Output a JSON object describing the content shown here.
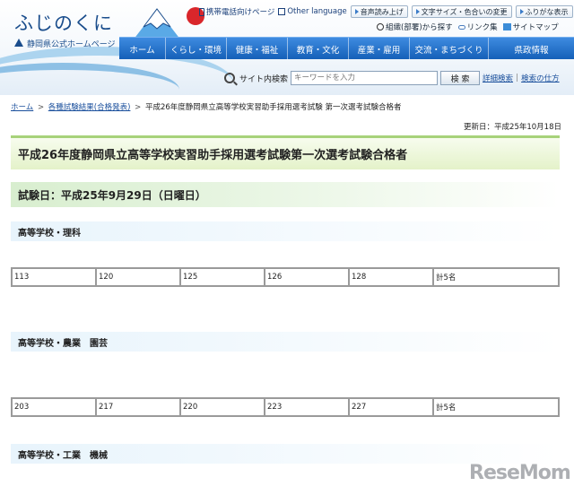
{
  "header": {
    "logo_title": "ふじのくに",
    "logo_sub": "静岡県公式ホームページ",
    "utility_links": [
      "携帯電話向けページ",
      "Other language"
    ],
    "utility_buttons": [
      "音声読み上げ",
      "文字サイズ・色合いの変更",
      "ふりがな表示"
    ],
    "utility_links2": [
      "組織(部署)から探す",
      "リンク集",
      "サイトマップ"
    ]
  },
  "nav": {
    "items": [
      "ホーム",
      "くらし・環境",
      "健康・福祉",
      "教育・文化",
      "産業・雇用",
      "交流・まちづくり",
      "県政情報"
    ]
  },
  "search": {
    "label": "サイト内検索",
    "placeholder": "キーワードを入力",
    "button": "検 索",
    "link_advanced": "詳細検索",
    "link_howto": "検索の仕方"
  },
  "breadcrumb": {
    "home": "ホーム",
    "category": "各種試験結果(合格発表)",
    "current": "平成26年度静岡県立高等学校実習助手採用選考試験 第一次選考試験合格者"
  },
  "updated": "更新日：平成25年10月18日",
  "page_title": "平成26年度静岡県立高等学校実習助手採用選考試験第一次選考試験合格者",
  "exam_date": "試験日：平成25年9月29日（日曜日）",
  "sections": [
    {
      "heading": "高等学校・理科",
      "cells": [
        "113",
        "120",
        "125",
        "126",
        "128",
        "計5名"
      ]
    },
    {
      "heading": "高等学校・農業　園芸",
      "cells": [
        "203",
        "217",
        "220",
        "223",
        "227",
        "計5名"
      ]
    },
    {
      "heading": "高等学校・工業　機械",
      "cells": []
    }
  ],
  "watermark": "ReseMom"
}
